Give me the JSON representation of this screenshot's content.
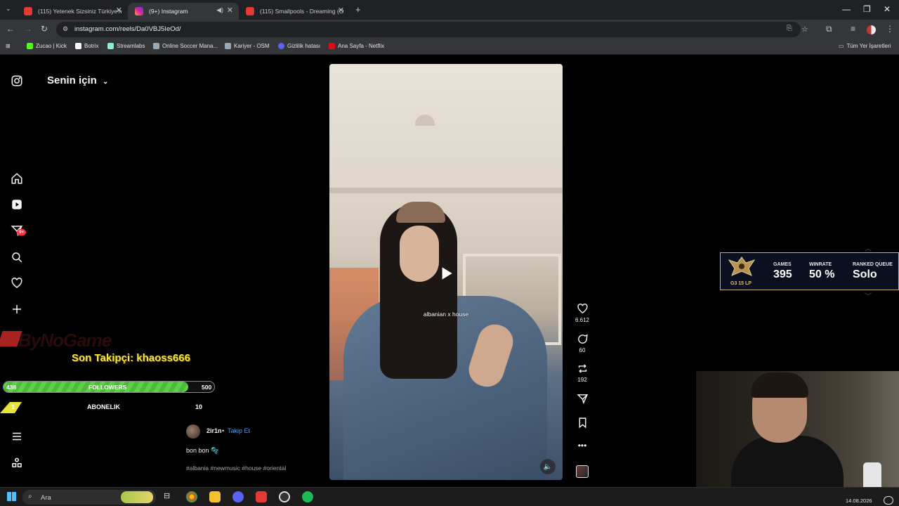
{
  "browser": {
    "tabs": [
      {
        "label": "(115) Yetenek Sizsiniz Türkiye'n",
        "icon": "youtube-icon"
      },
      {
        "label": "(9+) Instagram",
        "icon": "instagram-icon"
      },
      {
        "label": "(115) Smallpools - Dreaming (O",
        "icon": "youtube-icon"
      }
    ],
    "url": "instagram.com/reels/Da0VBJ5IeOd/",
    "bookmarks": [
      "Zucao | Kick",
      "Botrix",
      "Streamlabs",
      "Online Soccer Mana...",
      "Kariyer - OSM",
      "Gizlilik hatası",
      "Ana Sayfa - Netflix"
    ],
    "all_bookmarks": "Tüm Yer İşaretleri"
  },
  "instagram": {
    "feed_title": "Senin için",
    "notification_badge": "9+",
    "video_caption": "albanian x house",
    "likes": "6.612",
    "comments": "60",
    "reposts": "192",
    "username": "2ir1n",
    "follow_label": "Takip Et",
    "post_caption": "bon bon 🫧",
    "hashtags": "#albania #newmusic #house #oriental"
  },
  "stream_overlay": {
    "brand": "ByNoGame",
    "last_follower": "Son Takipçi: khaoss666",
    "followers": {
      "current": "438",
      "label": "FOLLOWERS",
      "goal": "500",
      "progress": 0.876
    },
    "subscriptions": {
      "current": "1",
      "label": "ABONELIK",
      "goal": "10",
      "progress": 0.1
    }
  },
  "rank_widget": {
    "tier": "G3 15 LP",
    "games_label": "GAMES",
    "games": "395",
    "winrate_label": "WINRATE",
    "winrate": "50 %",
    "queue_label": "RANKED QUEUE",
    "queue": "Solo"
  },
  "taskbar": {
    "search_placeholder": "Ara",
    "date": "14.08.2026"
  },
  "colors": {
    "accent": "#4f9cf9",
    "followers_bar": "#5fd148",
    "sub_bar": "#e8e33a",
    "follower_text": "#f7e23b"
  }
}
